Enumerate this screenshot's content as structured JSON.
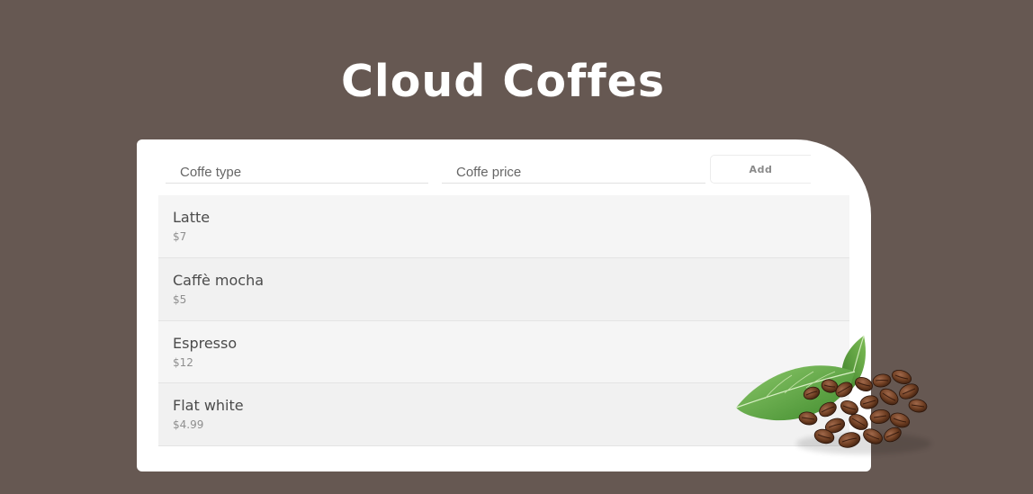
{
  "header": {
    "title": "Cloud Coffes"
  },
  "form": {
    "type_placeholder": "Coffe type",
    "price_placeholder": "Coffe price",
    "add_label": "Add"
  },
  "coffees": [
    {
      "name": "Latte",
      "price": "$7"
    },
    {
      "name": "Caffè mocha",
      "price": "$5"
    },
    {
      "name": "Espresso",
      "price": "$12"
    },
    {
      "name": "Flat white",
      "price": "$4.99"
    }
  ],
  "colors": {
    "background": "#665852",
    "card": "#ffffff",
    "row_odd": "#f5f5f5",
    "row_even": "#f1f1f1",
    "leaf": "#4f9a3a",
    "bean": "#6e3e22"
  },
  "decor": {
    "image": "coffee-beans-and-leaves"
  }
}
